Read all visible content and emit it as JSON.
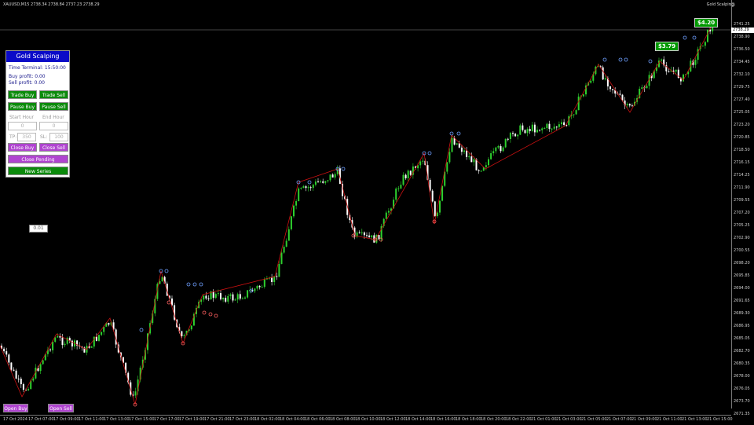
{
  "chart": {
    "symbol_info": "XAUUSD,M15  2738.34 2738.84 2737.23 2738.29",
    "ea_label": "Gold Scalping",
    "current_price": "2738.29",
    "price_labels": [
      "2741.25",
      "2738.90",
      "2736.50",
      "2734.45",
      "2732.10",
      "2729.75",
      "2727.40",
      "2725.05",
      "2723.20",
      "2720.85",
      "2718.50",
      "2716.15",
      "2714.25",
      "2711.90",
      "2709.55",
      "2707.20",
      "2705.25",
      "2702.90",
      "2700.55",
      "2698.20",
      "2695.85",
      "2694.00",
      "2691.65",
      "2689.30",
      "2686.95",
      "2685.05",
      "2682.70",
      "2680.35",
      "2678.00",
      "2676.05",
      "2673.70",
      "2671.35"
    ],
    "time_labels": [
      "17 Oct 2024",
      "17 Oct 07:00",
      "17 Oct 09:00",
      "17 Oct 11:00",
      "17 Oct 13:00",
      "17 Oct 15:00",
      "17 Oct 17:00",
      "17 Oct 19:00",
      "17 Oct 21:00",
      "17 Oct 23:00",
      "18 Oct 02:00",
      "18 Oct 04:00",
      "18 Oct 06:00",
      "18 Oct 08:00",
      "18 Oct 10:00",
      "18 Oct 12:00",
      "18 Oct 14:00",
      "18 Oct 16:00",
      "18 Oct 18:00",
      "18 Oct 20:00",
      "18 Oct 22:00",
      "21 Oct 01:00",
      "21 Oct 03:00",
      "21 Oct 05:00",
      "21 Oct 07:00",
      "21 Oct 09:00",
      "21 Oct 11:00",
      "21 Oct 13:00",
      "21 Oct 15:00"
    ],
    "profit_badge_1": "$4.20",
    "profit_badge_2": "$3.79"
  },
  "panel": {
    "title": "Gold Scalping",
    "time_terminal": "Time Terminal: 15:50:00",
    "buy_profit": "Buy profit:  0.00",
    "sell_profit": "Sell profit:  0.00",
    "trade_buy": "Trade Buy",
    "trade_sell": "Trade Sell",
    "pause_buy": "Pause Buy",
    "pause_sell": "Pause Sell",
    "start_hour_label": "Start Hour",
    "end_hour_label": "End Hour",
    "start_hour_value": "0",
    "end_hour_value": "0",
    "tp_label": "TP:",
    "tp_value": "350",
    "sl_label": "SL:",
    "sl_value": "100",
    "close_buy": "Close Buy",
    "close_sell": "Close Sell",
    "close_pending": "Close Pending",
    "new_series": "New Series"
  },
  "lot_size": "0.01",
  "open_buy": "Open Buy",
  "open_sell": "Open Sell",
  "colors": {
    "bull_candle": "#2ed12e",
    "bear_candle": "#ffffff",
    "zigzag": "#cc1111",
    "buy_marker": "#6fa0ff",
    "sell_marker": "#ff6060",
    "panel_title_bg": "#0a0ac8",
    "green_button": "#0b8a0b",
    "purple_button": "#b044d0"
  }
}
